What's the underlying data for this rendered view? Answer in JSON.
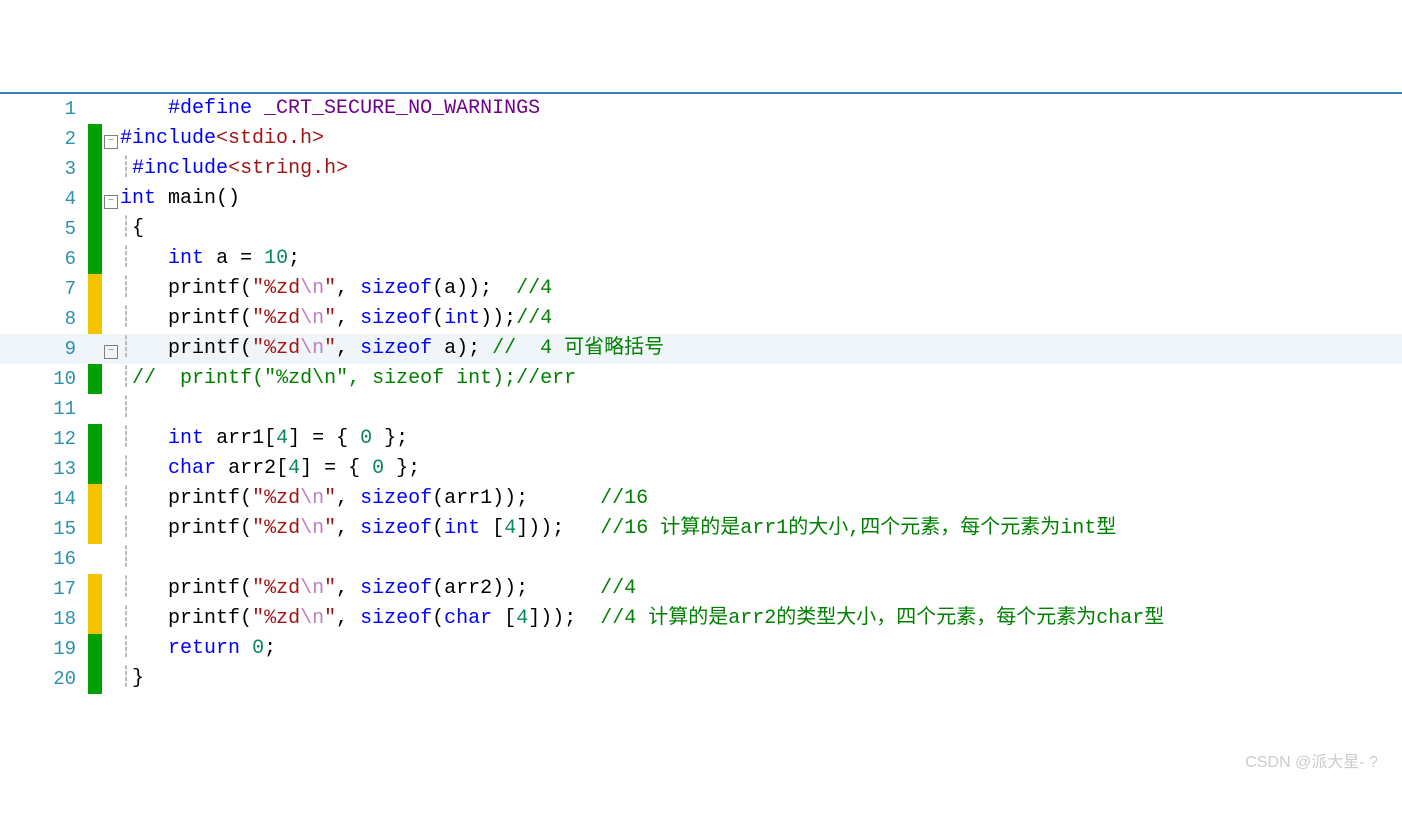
{
  "watermark": "CSDN @派大星- ?",
  "lines": [
    {
      "n": "1",
      "m": "none",
      "f": "",
      "g": "    ",
      "tokens": [
        {
          "c": "kw",
          "t": "#define"
        },
        {
          "c": "txt",
          "t": " "
        },
        {
          "c": "macro",
          "t": "_CRT_SECURE_NO_WARNINGS"
        }
      ]
    },
    {
      "n": "2",
      "m": "green",
      "f": "minus",
      "g": "",
      "tokens": [
        {
          "c": "kw",
          "t": "#include"
        },
        {
          "c": "hdr",
          "t": "<stdio.h>"
        }
      ]
    },
    {
      "n": "3",
      "m": "green",
      "f": "",
      "g": "|",
      "tokens": [
        {
          "c": "kw",
          "t": "#include"
        },
        {
          "c": "hdr",
          "t": "<string.h>"
        }
      ]
    },
    {
      "n": "4",
      "m": "green",
      "f": "minus",
      "g": "",
      "tokens": [
        {
          "c": "kw",
          "t": "int"
        },
        {
          "c": "txt",
          "t": " main()"
        }
      ]
    },
    {
      "n": "5",
      "m": "green",
      "f": "",
      "g": "|",
      "tokens": [
        {
          "c": "txt",
          "t": "{"
        }
      ]
    },
    {
      "n": "6",
      "m": "green",
      "f": "",
      "g": "|   ",
      "tokens": [
        {
          "c": "kw",
          "t": "int"
        },
        {
          "c": "txt",
          "t": " a = "
        },
        {
          "c": "num",
          "t": "10"
        },
        {
          "c": "txt",
          "t": ";"
        }
      ]
    },
    {
      "n": "7",
      "m": "yellow",
      "f": "",
      "g": "|   ",
      "tokens": [
        {
          "c": "txt",
          "t": "printf("
        },
        {
          "c": "str",
          "t": "\"%zd"
        },
        {
          "c": "esc",
          "t": "\\n"
        },
        {
          "c": "str",
          "t": "\""
        },
        {
          "c": "txt",
          "t": ", "
        },
        {
          "c": "kw",
          "t": "sizeof"
        },
        {
          "c": "txt",
          "t": "(a));  "
        },
        {
          "c": "cm",
          "t": "//4"
        }
      ]
    },
    {
      "n": "8",
      "m": "yellow",
      "f": "",
      "g": "|   ",
      "tokens": [
        {
          "c": "txt",
          "t": "printf("
        },
        {
          "c": "str",
          "t": "\"%zd"
        },
        {
          "c": "esc",
          "t": "\\n"
        },
        {
          "c": "str",
          "t": "\""
        },
        {
          "c": "txt",
          "t": ", "
        },
        {
          "c": "kw",
          "t": "sizeof"
        },
        {
          "c": "txt",
          "t": "("
        },
        {
          "c": "kw",
          "t": "int"
        },
        {
          "c": "txt",
          "t": "));"
        },
        {
          "c": "cm",
          "t": "//4"
        }
      ]
    },
    {
      "n": "9",
      "m": "none",
      "f": "minus",
      "g": "|   ",
      "hl": true,
      "tokens": [
        {
          "c": "txt",
          "t": "printf("
        },
        {
          "c": "str",
          "t": "\"%zd"
        },
        {
          "c": "esc",
          "t": "\\n"
        },
        {
          "c": "str",
          "t": "\""
        },
        {
          "c": "txt",
          "t": ", "
        },
        {
          "c": "kw",
          "t": "sizeof"
        },
        {
          "c": "txt",
          "t": " a); "
        },
        {
          "c": "cm",
          "t": "//  4 可省略括号"
        }
      ]
    },
    {
      "n": "10",
      "m": "green",
      "f": "",
      "g": "|",
      "tokens": [
        {
          "c": "cm",
          "t": "//  printf(\"%zd\\n\", sizeof int);//err"
        }
      ]
    },
    {
      "n": "11",
      "m": "none",
      "f": "",
      "g": "|",
      "tokens": []
    },
    {
      "n": "12",
      "m": "green",
      "f": "",
      "g": "|   ",
      "tokens": [
        {
          "c": "kw",
          "t": "int"
        },
        {
          "c": "txt",
          "t": " arr1["
        },
        {
          "c": "num",
          "t": "4"
        },
        {
          "c": "txt",
          "t": "] = { "
        },
        {
          "c": "num",
          "t": "0"
        },
        {
          "c": "txt",
          "t": " };"
        }
      ]
    },
    {
      "n": "13",
      "m": "green",
      "f": "",
      "g": "|   ",
      "tokens": [
        {
          "c": "kw",
          "t": "char"
        },
        {
          "c": "txt",
          "t": " arr2["
        },
        {
          "c": "num",
          "t": "4"
        },
        {
          "c": "txt",
          "t": "] = { "
        },
        {
          "c": "num",
          "t": "0"
        },
        {
          "c": "txt",
          "t": " };"
        }
      ]
    },
    {
      "n": "14",
      "m": "yellow",
      "f": "",
      "g": "|   ",
      "tokens": [
        {
          "c": "txt",
          "t": "printf("
        },
        {
          "c": "str",
          "t": "\"%zd"
        },
        {
          "c": "esc",
          "t": "\\n"
        },
        {
          "c": "str",
          "t": "\""
        },
        {
          "c": "txt",
          "t": ", "
        },
        {
          "c": "kw",
          "t": "sizeof"
        },
        {
          "c": "txt",
          "t": "(arr1));      "
        },
        {
          "c": "cm",
          "t": "//16"
        }
      ]
    },
    {
      "n": "15",
      "m": "yellow",
      "f": "",
      "g": "|   ",
      "tokens": [
        {
          "c": "txt",
          "t": "printf("
        },
        {
          "c": "str",
          "t": "\"%zd"
        },
        {
          "c": "esc",
          "t": "\\n"
        },
        {
          "c": "str",
          "t": "\""
        },
        {
          "c": "txt",
          "t": ", "
        },
        {
          "c": "kw",
          "t": "sizeof"
        },
        {
          "c": "txt",
          "t": "("
        },
        {
          "c": "kw",
          "t": "int"
        },
        {
          "c": "txt",
          "t": " ["
        },
        {
          "c": "num",
          "t": "4"
        },
        {
          "c": "txt",
          "t": "]));   "
        },
        {
          "c": "cm",
          "t": "//16 计算的是arr1的大小,四个元素，每个元素为int型"
        }
      ]
    },
    {
      "n": "16",
      "m": "none",
      "f": "",
      "g": "|",
      "tokens": []
    },
    {
      "n": "17",
      "m": "yellow",
      "f": "",
      "g": "|   ",
      "tokens": [
        {
          "c": "txt",
          "t": "printf("
        },
        {
          "c": "str",
          "t": "\"%zd"
        },
        {
          "c": "esc",
          "t": "\\n"
        },
        {
          "c": "str",
          "t": "\""
        },
        {
          "c": "txt",
          "t": ", "
        },
        {
          "c": "kw",
          "t": "sizeof"
        },
        {
          "c": "txt",
          "t": "(arr2));      "
        },
        {
          "c": "cm",
          "t": "//4"
        }
      ]
    },
    {
      "n": "18",
      "m": "yellow",
      "f": "",
      "g": "|   ",
      "tokens": [
        {
          "c": "txt",
          "t": "printf("
        },
        {
          "c": "str",
          "t": "\"%zd"
        },
        {
          "c": "esc",
          "t": "\\n"
        },
        {
          "c": "str",
          "t": "\""
        },
        {
          "c": "txt",
          "t": ", "
        },
        {
          "c": "kw",
          "t": "sizeof"
        },
        {
          "c": "txt",
          "t": "("
        },
        {
          "c": "kw",
          "t": "char"
        },
        {
          "c": "txt",
          "t": " ["
        },
        {
          "c": "num",
          "t": "4"
        },
        {
          "c": "txt",
          "t": "]));  "
        },
        {
          "c": "cm",
          "t": "//4 计算的是arr2的类型大小，四个元素，每个元素为char型"
        }
      ]
    },
    {
      "n": "19",
      "m": "green",
      "f": "",
      "g": "|   ",
      "tokens": [
        {
          "c": "kw",
          "t": "return"
        },
        {
          "c": "txt",
          "t": " "
        },
        {
          "c": "num",
          "t": "0"
        },
        {
          "c": "txt",
          "t": ";"
        }
      ]
    },
    {
      "n": "20",
      "m": "green",
      "f": "",
      "g": "|",
      "tokens": [
        {
          "c": "txt",
          "t": "}"
        }
      ]
    }
  ]
}
